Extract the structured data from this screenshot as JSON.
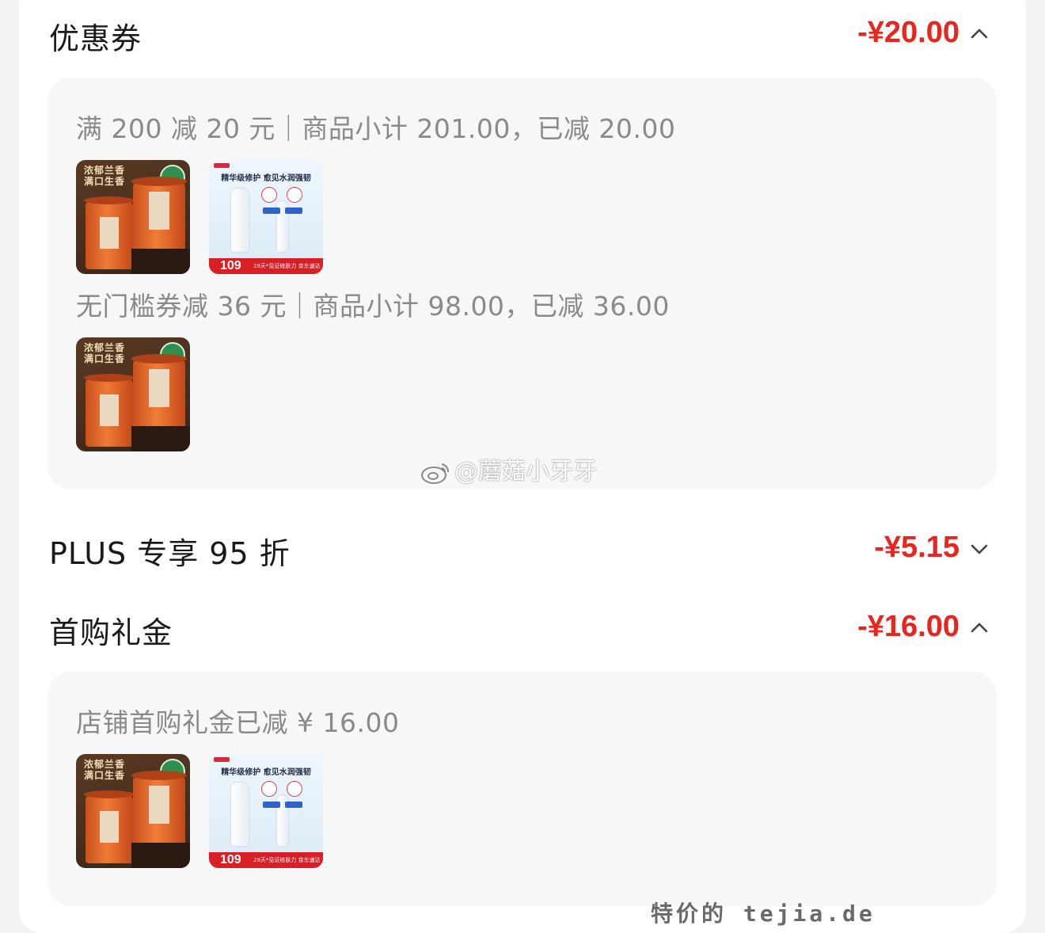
{
  "coupon": {
    "title": "优惠券",
    "amount": "-¥20.00",
    "rules": [
      {
        "text": "满 200 减 20 元｜商品小计 201.00，已减 20.00"
      },
      {
        "text": "无门槛券减 36 元｜商品小计 98.00，已减 36.00"
      }
    ]
  },
  "plus": {
    "title": "PLUS 专享 95 折",
    "amount": "-¥5.15"
  },
  "first_purchase": {
    "title": "首购礼金",
    "amount": "-¥16.00",
    "rule": "店铺首购礼金已减 ¥ 16.00"
  },
  "products": {
    "tea": {
      "line1": "浓郁兰香",
      "line2": "满口生香"
    },
    "skincare": {
      "headline": "精华级修护 愈见水润强韧",
      "price": "109",
      "slogan": "28天*见证修肤力 京东速达"
    }
  },
  "watermark": "@蘑菇小牙牙",
  "site_mark": "特价的 tejia.de",
  "colors": {
    "accent": "#e8251f",
    "panel": "#f7f7f7",
    "muted_text": "#8a8a8a"
  },
  "icons": {
    "expanded": "chevron-up-icon",
    "collapsed": "chevron-down-icon"
  }
}
